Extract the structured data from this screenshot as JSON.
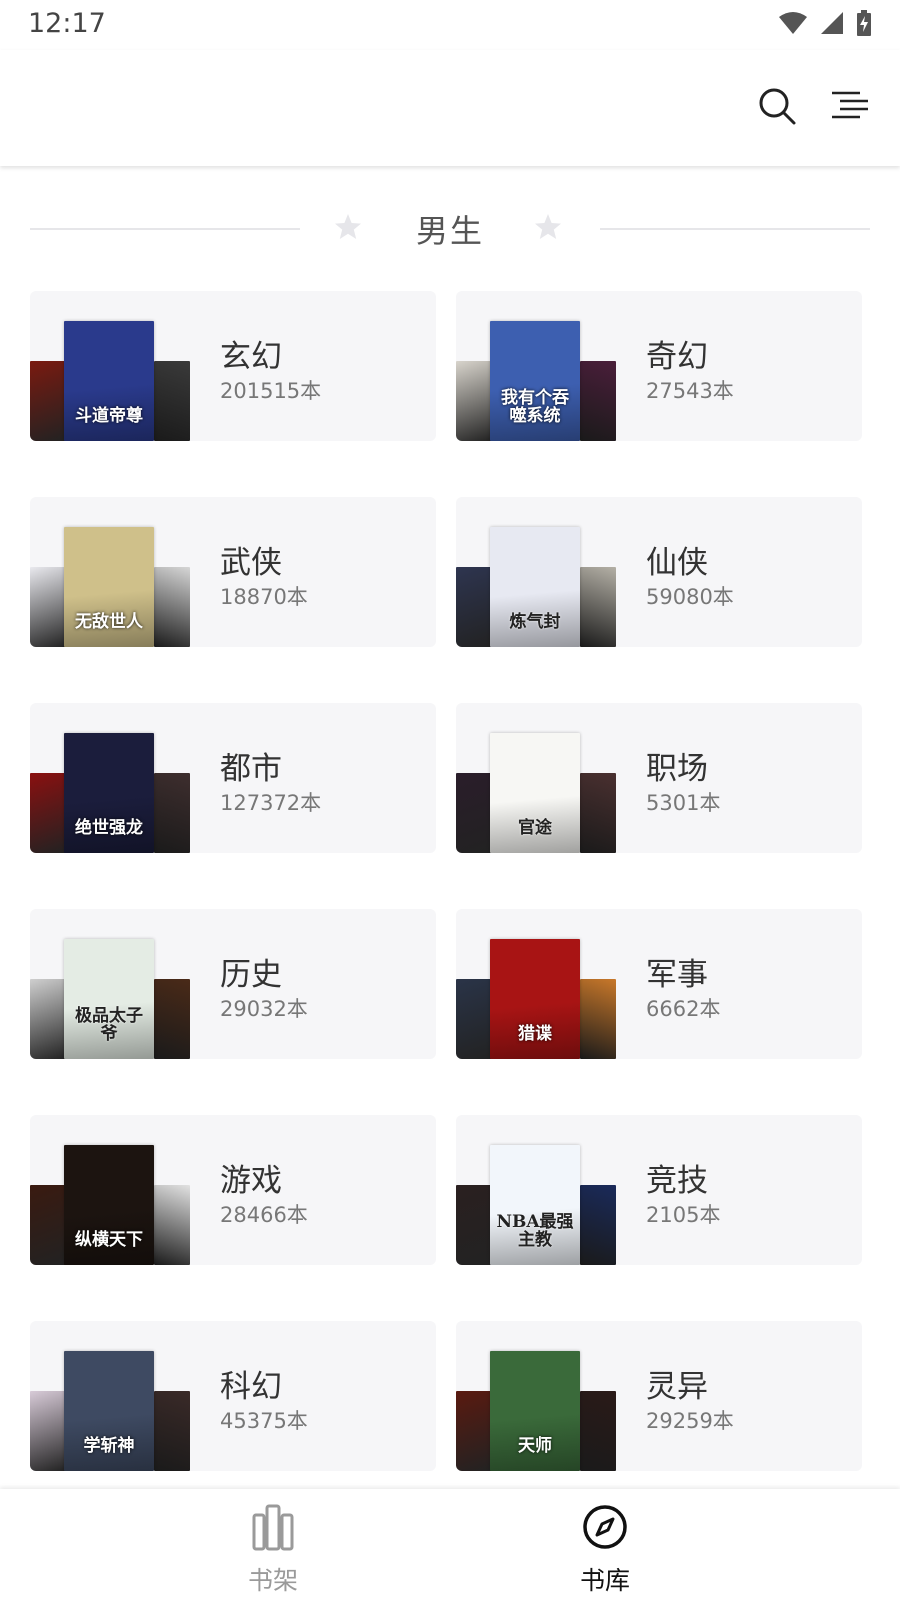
{
  "status_bar": {
    "time": "12:17"
  },
  "toolbar": {
    "search_icon": "search-icon",
    "menu_icon": "list-menu-icon"
  },
  "section": {
    "title": "男生"
  },
  "categories": [
    {
      "name": "玄幻",
      "count": "201515本",
      "main_color": "#2a3a8c",
      "left_color": "#7a1a10",
      "right_color": "#3a3a3a",
      "cover_text": "斗道帝尊"
    },
    {
      "name": "奇幻",
      "count": "27543本",
      "main_color": "#3d5fb0",
      "left_color": "#d8d4cc",
      "right_color": "#4a1e3a",
      "cover_text": "我有个吞噬系统"
    },
    {
      "name": "武侠",
      "count": "18870本",
      "main_color": "#cfc08a",
      "left_color": "#e9e9ee",
      "right_color": "#d6d6d6",
      "cover_text": "无敌世人"
    },
    {
      "name": "仙侠",
      "count": "59080本",
      "main_color": "#e7e9f2",
      "left_color": "#2e3550",
      "right_color": "#b4b0a6",
      "cover_text": "炼气封"
    },
    {
      "name": "都市",
      "count": "127372本",
      "main_color": "#1b1d3c",
      "left_color": "#8a1010",
      "right_color": "#3e2e2e",
      "cover_text": "绝世强龙"
    },
    {
      "name": "职场",
      "count": "5301本",
      "main_color": "#f7f7f4",
      "left_color": "#2a1d2a",
      "right_color": "#4a3030",
      "cover_text": "官途"
    },
    {
      "name": "历史",
      "count": "29032本",
      "main_color": "#e4ece4",
      "left_color": "#cfcfcf",
      "right_color": "#4a2a18",
      "cover_text": "极品太子爷"
    },
    {
      "name": "军事",
      "count": "6662本",
      "main_color": "#a81414",
      "left_color": "#2a3448",
      "right_color": "#c8782a",
      "cover_text": "猎谍"
    },
    {
      "name": "游戏",
      "count": "28466本",
      "main_color": "#1c1410",
      "left_color": "#3a1a10",
      "right_color": "#e2e2e2",
      "cover_text": "纵横天下"
    },
    {
      "name": "竞技",
      "count": "2105本",
      "main_color": "#f2f6fb",
      "left_color": "#2a2020",
      "right_color": "#1a2a5a",
      "cover_text": "NBA最强主教"
    },
    {
      "name": "科幻",
      "count": "45375本",
      "main_color": "#3e4a62",
      "left_color": "#d8cbd8",
      "right_color": "#3a2a28",
      "cover_text": "学斩神"
    },
    {
      "name": "灵异",
      "count": "29259本",
      "main_color": "#3a6a3a",
      "left_color": "#5a1a10",
      "right_color": "#2a1a18",
      "cover_text": "天师"
    }
  ],
  "bottom_nav": {
    "items": [
      {
        "label": "书架",
        "icon": "bookshelf-icon",
        "active": false
      },
      {
        "label": "书库",
        "icon": "compass-icon",
        "active": true
      }
    ],
    "colors": {
      "active": "#111111",
      "inactive": "#9a9a9a"
    }
  }
}
